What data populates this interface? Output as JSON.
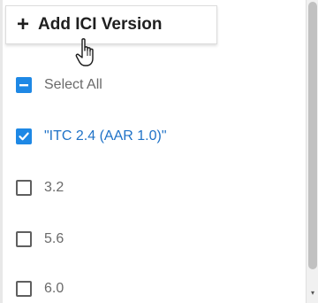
{
  "add_button": {
    "label": "Add ICI Version",
    "icon": "plus-icon"
  },
  "list": {
    "items": [
      {
        "label": "Select All",
        "state": "indeterminate"
      },
      {
        "label": "\"ITC 2.4 (AAR 1.0)\"",
        "state": "checked"
      },
      {
        "label": "3.2",
        "state": "unchecked"
      },
      {
        "label": "5.6",
        "state": "unchecked"
      },
      {
        "label": "6.0",
        "state": "unchecked"
      }
    ]
  },
  "colors": {
    "accent": "#1e88e5",
    "selected_text": "#1f72c7",
    "text": "#6a6a6a"
  }
}
